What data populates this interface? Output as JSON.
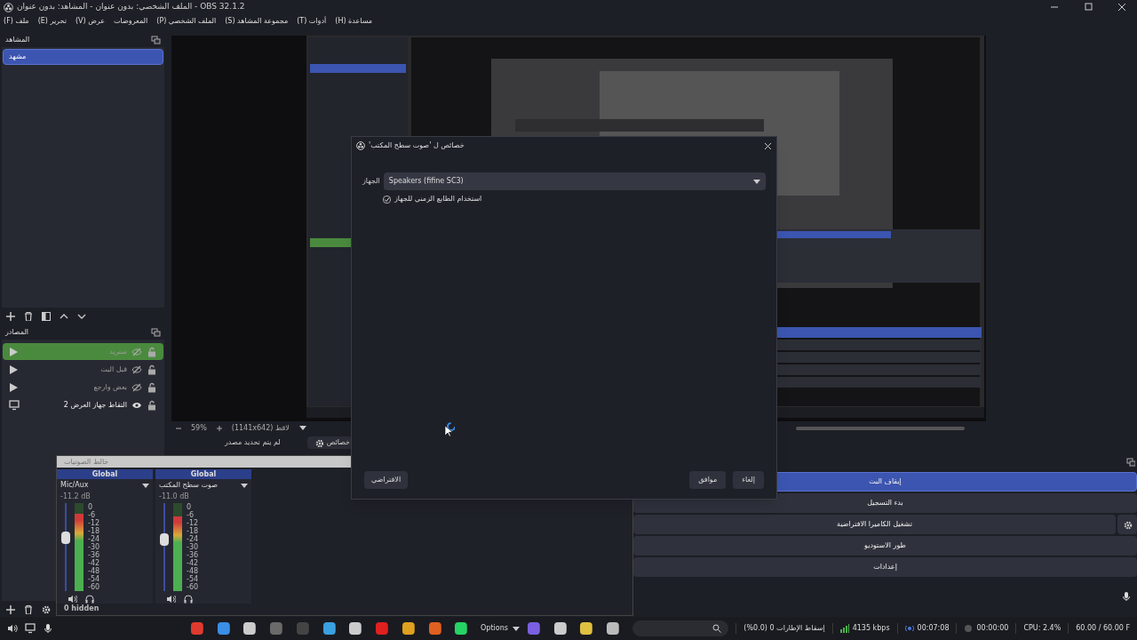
{
  "window": {
    "title": "OBS 32.1.2 - الملف الشخصي: بدون عنوان - المشاهد: بدون عنوان"
  },
  "menu": [
    {
      "label": "مساعدة (H)"
    },
    {
      "label": "أدوات (T)"
    },
    {
      "label": "مجموعة المشاهد (S)"
    },
    {
      "label": "الملف الشخصي (P)"
    },
    {
      "label": "المعروضات"
    },
    {
      "label": "عرض (V)"
    },
    {
      "label": "تحرير (E)"
    },
    {
      "label": "ملف (F)"
    }
  ],
  "scenes": {
    "title": "المشاهد",
    "items": [
      {
        "label": "مشهد",
        "selected": true
      }
    ]
  },
  "sources": {
    "title": "المصادر",
    "items": [
      {
        "name": "ستريد",
        "kind": "media",
        "visible": false,
        "locked": false,
        "selected": true
      },
      {
        "name": "قبل البث",
        "kind": "media",
        "visible": false,
        "locked": false,
        "selected": false
      },
      {
        "name": "بعض وارجع",
        "kind": "media",
        "visible": false,
        "locked": false,
        "selected": false
      },
      {
        "name": "التقاط جهاز العرض 2",
        "kind": "display",
        "visible": true,
        "locked": false,
        "selected": false
      }
    ]
  },
  "preview_bar": {
    "zoom": "59%",
    "resolution": "لاقط (1141x642)"
  },
  "context_bar": {
    "message": "لم يتم تحديد مصدر",
    "button": "خصائص"
  },
  "dialog": {
    "title": "خصائص ل 'صوت سطح المكتب'",
    "device_label": "الجهاز",
    "device_value": "Speakers (fifine SC3)",
    "timestamps": {
      "label": "استخدام الطابع الزمني للجهاز",
      "checked": true
    },
    "defaults_button": "الافتراضي",
    "ok_button": "موافق",
    "cancel_button": "إلغاء"
  },
  "mixer": {
    "title": "خالط الصوتيات",
    "hidden_count": "0 hidden",
    "channels": [
      {
        "badge": "Global",
        "name": "صوت سطح المكتب",
        "reading": "-11.0 dB",
        "fader": {
          "level": 0.6
        },
        "meter": {
          "level": 0.85
        },
        "ticks": [
          "0",
          "-6",
          "-12",
          "-18",
          "-24",
          "-30",
          "-36",
          "-42",
          "-48",
          "-54",
          "-60"
        ]
      },
      {
        "badge": "Global",
        "name": "Mic/Aux",
        "reading": "-11.2 dB",
        "fader": {
          "level": 0.62
        },
        "meter": {
          "level": 0.88
        },
        "ticks": [
          "0",
          "-6",
          "-12",
          "-18",
          "-24",
          "-30",
          "-36",
          "-42",
          "-48",
          "-54",
          "-60"
        ]
      }
    ]
  },
  "controls": [
    {
      "label": "إيقاف البث",
      "kind": "plain",
      "active": true
    },
    {
      "label": "بدء التسجيل",
      "kind": "plain",
      "active": false
    },
    {
      "label": "تشغيل الكاميرا الافتراضية",
      "kind": "with-settings",
      "active": false
    },
    {
      "label": "طور الاستوديو",
      "kind": "plain",
      "active": false
    },
    {
      "label": "إعدادات",
      "kind": "plain",
      "active": false
    }
  ],
  "taskbar": {
    "options": "Options"
  },
  "status": {
    "dropped": "إسقاط الإطارات 0 (0.0%)",
    "bitrate": "4135 kbps",
    "stream_time": "00:07:08",
    "record_time": "00:00:00",
    "cpu": "CPU: 2.4%",
    "fps": "60.00 / 60.00 F"
  }
}
